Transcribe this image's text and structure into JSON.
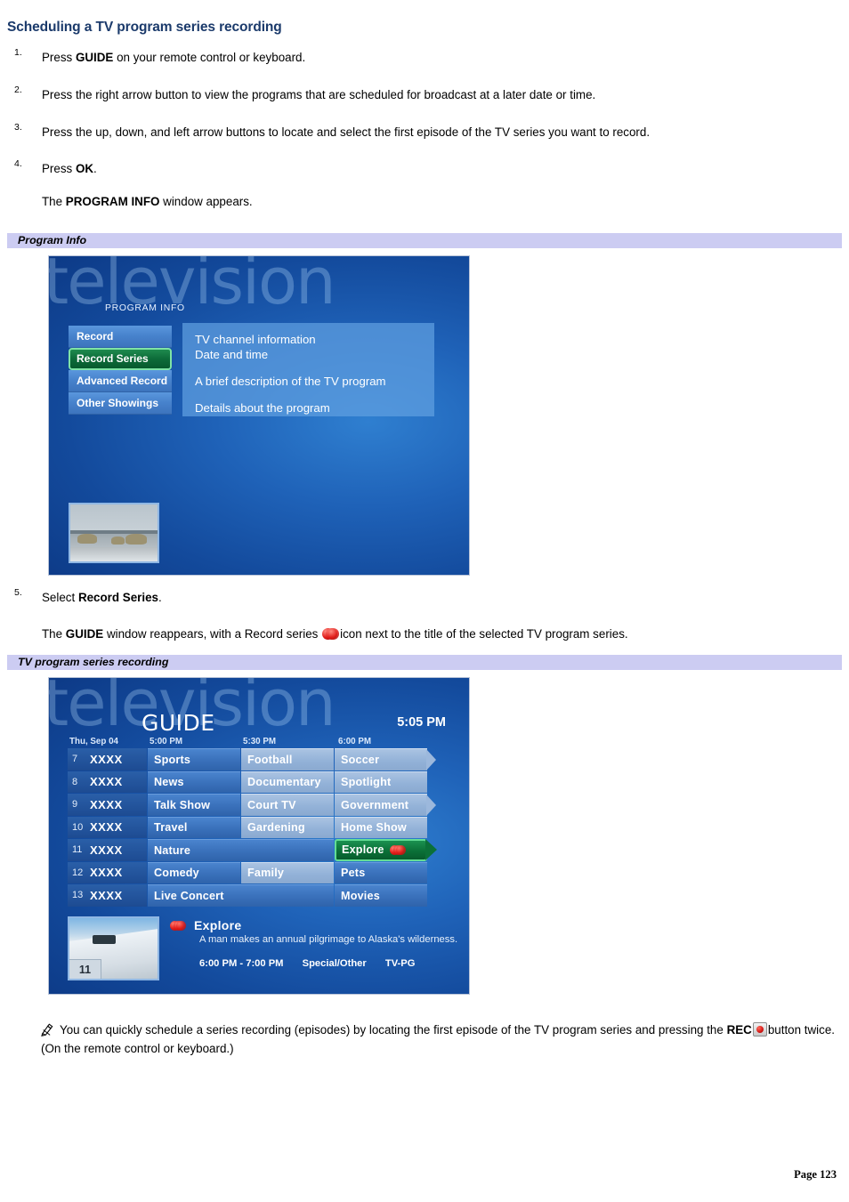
{
  "heading": "Scheduling a TV program series recording",
  "steps": [
    {
      "num": "1.",
      "html_key": "s1",
      "text_before": "Press ",
      "bold": "GUIDE",
      "text_after": " on your remote control or keyboard."
    },
    {
      "num": "2.",
      "html_key": "s2",
      "text_before": "Press the right arrow button to view the programs that are scheduled for broadcast at a later date or time.",
      "bold": "",
      "text_after": ""
    },
    {
      "num": "3.",
      "html_key": "s3",
      "text_before": "Press the up, down, and left arrow buttons to locate and select the first episode of the TV series you want to record.",
      "bold": "",
      "text_after": ""
    },
    {
      "num": "4.",
      "html_key": "s4",
      "text_before": "Press ",
      "bold": "OK",
      "text_after": "."
    },
    {
      "num": "5.",
      "html_key": "s5",
      "text_before": "Select ",
      "bold": "Record Series",
      "text_after": "."
    }
  ],
  "after_step4": {
    "before": "The ",
    "bold": "PROGRAM INFO",
    "after": " window appears."
  },
  "after_step5": {
    "before": "The ",
    "bold": "GUIDE",
    "middle": " window reappears, with a Record series ",
    "icon_name": "record-series-icon",
    "after": "icon next to the title of the selected TV program series."
  },
  "captions": {
    "program_info": "Program Info",
    "tv_series_recording": "TV program series recording"
  },
  "program_info_screen": {
    "watermark": "television",
    "title": "PROGRAM INFO",
    "menu": [
      {
        "label": "Record",
        "selected": false
      },
      {
        "label": "Record Series",
        "selected": true
      },
      {
        "label": "Advanced Record",
        "selected": false
      },
      {
        "label": "Other Showings",
        "selected": false
      }
    ],
    "detail_lines": [
      "TV channel information",
      "Date and time",
      "A brief description of the TV program",
      "Details about the program"
    ],
    "thumbnail_alt": "polar-bears-on-snow"
  },
  "guide_screen": {
    "watermark": "television",
    "title": "GUIDE",
    "clock": "5:05 PM",
    "date_label": "Thu, Sep 04",
    "time_columns": [
      "5:00 PM",
      "5:30 PM",
      "6:00 PM"
    ],
    "rows": [
      {
        "channel": "7",
        "call_sign": "XXXX",
        "cells": [
          {
            "label": "Sports",
            "span": 1,
            "style": "dark",
            "arrow": false,
            "selected": false,
            "icon": false
          },
          {
            "label": "Football",
            "span": 1,
            "style": "light",
            "arrow": false,
            "selected": false,
            "icon": false
          },
          {
            "label": "Soccer",
            "span": 1,
            "style": "light",
            "arrow": true,
            "selected": false,
            "icon": false
          }
        ]
      },
      {
        "channel": "8",
        "call_sign": "XXXX",
        "cells": [
          {
            "label": "News",
            "span": 1,
            "style": "dark",
            "arrow": false,
            "selected": false,
            "icon": false
          },
          {
            "label": "Documentary",
            "span": 1,
            "style": "light",
            "arrow": false,
            "selected": false,
            "icon": false
          },
          {
            "label": "Spotlight",
            "span": 1,
            "style": "light",
            "arrow": false,
            "selected": false,
            "icon": false
          }
        ]
      },
      {
        "channel": "9",
        "call_sign": "XXXX",
        "cells": [
          {
            "label": "Talk Show",
            "span": 1,
            "style": "dark",
            "arrow": false,
            "selected": false,
            "icon": false
          },
          {
            "label": "Court TV",
            "span": 1,
            "style": "light",
            "arrow": false,
            "selected": false,
            "icon": false
          },
          {
            "label": "Government",
            "span": 1,
            "style": "light",
            "arrow": true,
            "selected": false,
            "icon": false
          }
        ]
      },
      {
        "channel": "10",
        "call_sign": "XXXX",
        "cells": [
          {
            "label": "Travel",
            "span": 1,
            "style": "dark",
            "arrow": false,
            "selected": false,
            "icon": false
          },
          {
            "label": "Gardening",
            "span": 1,
            "style": "light",
            "arrow": false,
            "selected": false,
            "icon": false
          },
          {
            "label": "Home Show",
            "span": 1,
            "style": "light",
            "arrow": false,
            "selected": false,
            "icon": false
          }
        ]
      },
      {
        "channel": "11",
        "call_sign": "XXXX",
        "cells": [
          {
            "label": "Nature",
            "span": 2,
            "style": "dark",
            "arrow": false,
            "selected": false,
            "icon": false
          },
          {
            "label": "Explore",
            "span": 1,
            "style": "dark",
            "arrow": true,
            "selected": true,
            "icon": true
          }
        ]
      },
      {
        "channel": "12",
        "call_sign": "XXXX",
        "cells": [
          {
            "label": "Comedy",
            "span": 1,
            "style": "dark",
            "arrow": false,
            "selected": false,
            "icon": false
          },
          {
            "label": "Family",
            "span": 1,
            "style": "light",
            "arrow": false,
            "selected": false,
            "icon": false
          },
          {
            "label": "Pets",
            "span": 1,
            "style": "dark",
            "arrow": false,
            "selected": false,
            "icon": false
          }
        ]
      },
      {
        "channel": "13",
        "call_sign": "XXXX",
        "cells": [
          {
            "label": "Live Concert",
            "span": 2,
            "style": "dark",
            "arrow": false,
            "selected": false,
            "icon": false
          },
          {
            "label": "Movies",
            "span": 1,
            "style": "dark",
            "arrow": false,
            "selected": false,
            "icon": false
          }
        ]
      }
    ],
    "info_panel": {
      "thumbnail_channel": "11",
      "thumbnail_alt": "snowy-hill-with-vehicle",
      "title": "Explore",
      "description": "A man makes an annual pilgrimage to Alaska's wilderness.",
      "time_range": "6:00 PM - 7:00 PM",
      "genre": "Special/Other",
      "rating": "TV-PG"
    }
  },
  "tip": {
    "icon_name": "note-pencil-icon",
    "part1": "You can quickly schedule a series recording (episodes) by locating the first episode of the TV program series and pressing the ",
    "bold": "REC",
    "part2": "button twice. (On the remote control or keyboard.)"
  },
  "footer": {
    "page_label": "Page 123"
  },
  "colors": {
    "heading": "#1b3a6b",
    "caption_bar": "#ccccf2",
    "selected_green": "#0b7038",
    "record_red": "#e01a17",
    "tv_blue": "#1f62b8"
  }
}
